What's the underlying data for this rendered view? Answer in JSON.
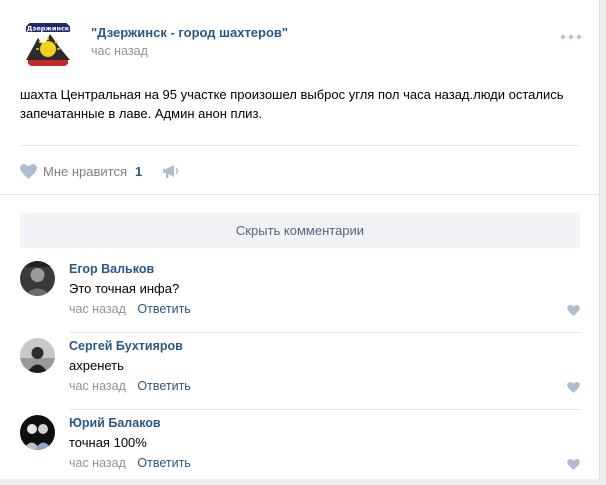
{
  "post": {
    "group_name": "\"Дзержинск - город шахтеров\"",
    "logo_text": "Дзержинск",
    "time": "час назад",
    "text": "шахта Центральная на 95 участке произошел выброс угля пол часа назад.люди остались запечатанные в лаве. Админ анон плиз.",
    "like_label": "Мне нравится",
    "like_count": "1",
    "icons": {
      "more": "more-dots-icon",
      "like": "heart-icon",
      "share": "megaphone-icon"
    }
  },
  "comments_section": {
    "hide_label": "Скрыть комментарии",
    "items": [
      {
        "author": "Егор Вальков",
        "text": "Это точная инфа?",
        "time": "час назад",
        "reply": "Ответить"
      },
      {
        "author": "Сергей Бухтияров",
        "text": "ахренеть",
        "time": "час назад",
        "reply": "Ответить"
      },
      {
        "author": "Юрий Балаков",
        "text": "точная 100%",
        "time": "час назад",
        "reply": "Ответить"
      }
    ]
  },
  "colors": {
    "link": "#2a5885",
    "muted": "#939393",
    "heart": "#aebed0",
    "background": "#edeef0"
  }
}
